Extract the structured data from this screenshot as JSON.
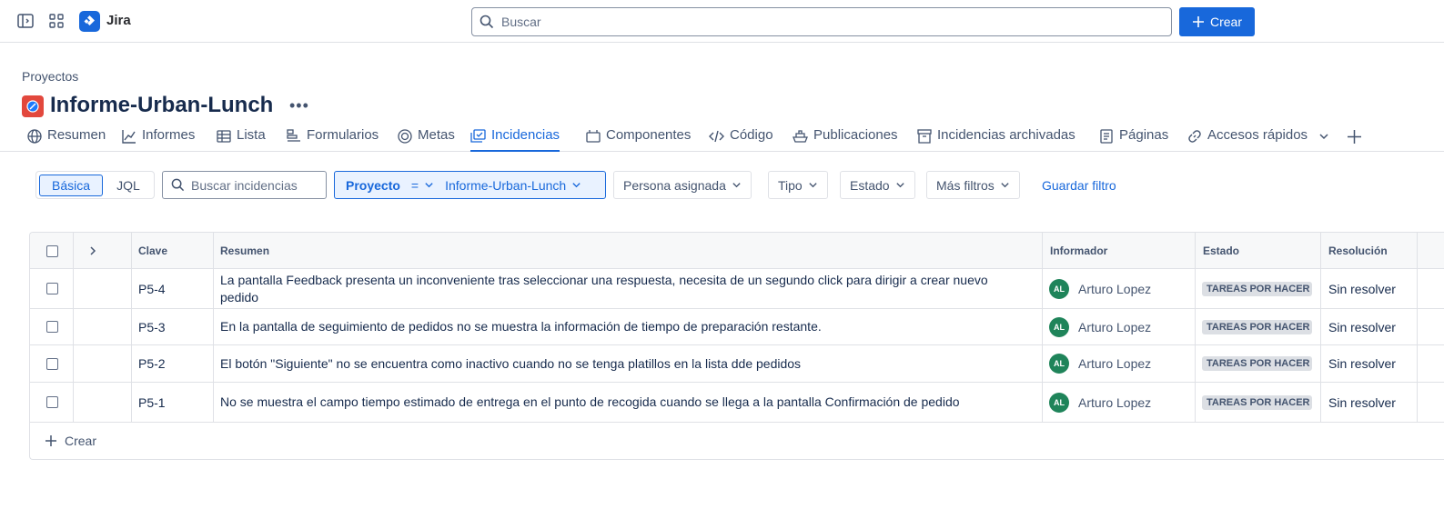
{
  "app": {
    "name": "Jira"
  },
  "topbar": {
    "search_placeholder": "Buscar",
    "create_label": "Crear"
  },
  "header": {
    "breadcrumb": "Proyectos",
    "title": "Informe-Urban-Lunch"
  },
  "tabs": [
    {
      "label": "Resumen",
      "icon": "globe-icon"
    },
    {
      "label": "Informes",
      "icon": "chart-line-icon"
    },
    {
      "label": "Lista",
      "icon": "list-table-icon"
    },
    {
      "label": "Formularios",
      "icon": "forms-icon"
    },
    {
      "label": "Metas",
      "icon": "goal-target-icon"
    },
    {
      "label": "Incidencias",
      "icon": "issues-icon",
      "active": true
    },
    {
      "label": "Componentes",
      "icon": "components-icon"
    },
    {
      "label": "Código",
      "icon": "code-icon"
    },
    {
      "label": "Publicaciones",
      "icon": "ship-icon"
    },
    {
      "label": "Incidencias archivadas",
      "icon": "archive-icon"
    },
    {
      "label": "Páginas",
      "icon": "page-icon"
    },
    {
      "label": "Accesos rápidos",
      "icon": "link-icon"
    }
  ],
  "filters": {
    "mode_basic": "Básica",
    "mode_jql": "JQL",
    "search_placeholder": "Buscar incidencias",
    "project_label": "Proyecto",
    "project_operator": "=",
    "project_value": "Informe-Urban-Lunch",
    "assignee": "Persona asignada",
    "type": "Tipo",
    "status": "Estado",
    "more": "Más filtros",
    "save": "Guardar filtro"
  },
  "table": {
    "headers": {
      "key": "Clave",
      "summary": "Resumen",
      "reporter": "Informador",
      "status": "Estado",
      "resolution": "Resolución"
    },
    "rows": [
      {
        "key": "P5-4",
        "summary": "La pantalla Feedback presenta un inconveniente tras seleccionar una respuesta, necesita de un segundo click para dirigir a crear nuevo pedido",
        "reporter_initials": "AL",
        "reporter": "Arturo Lopez",
        "status": "TAREAS POR HACER",
        "resolution": "Sin resolver"
      },
      {
        "key": "P5-3",
        "summary": "En la pantalla de seguimiento de pedidos no se muestra la información de tiempo de preparación restante.",
        "reporter_initials": "AL",
        "reporter": "Arturo Lopez",
        "status": "TAREAS POR HACER",
        "resolution": "Sin resolver"
      },
      {
        "key": "P5-2",
        "summary": "El botón \"Siguiente\" no se encuentra como inactivo cuando no se tenga platillos en la lista dde pedidos",
        "reporter_initials": "AL",
        "reporter": "Arturo Lopez",
        "status": "TAREAS POR HACER",
        "resolution": "Sin resolver"
      },
      {
        "key": "P5-1",
        "summary": "No se muestra el campo tiempo estimado de entrega en el punto de recogida cuando se llega a la pantalla Confirmación de pedido",
        "reporter_initials": "AL",
        "reporter": "Arturo Lopez",
        "status": "TAREAS POR HACER",
        "resolution": "Sin resolver"
      }
    ],
    "create_label": "Crear"
  },
  "colors": {
    "accent": "#1868db",
    "project_icon": "#e2483d",
    "avatar": "#1f845a"
  }
}
